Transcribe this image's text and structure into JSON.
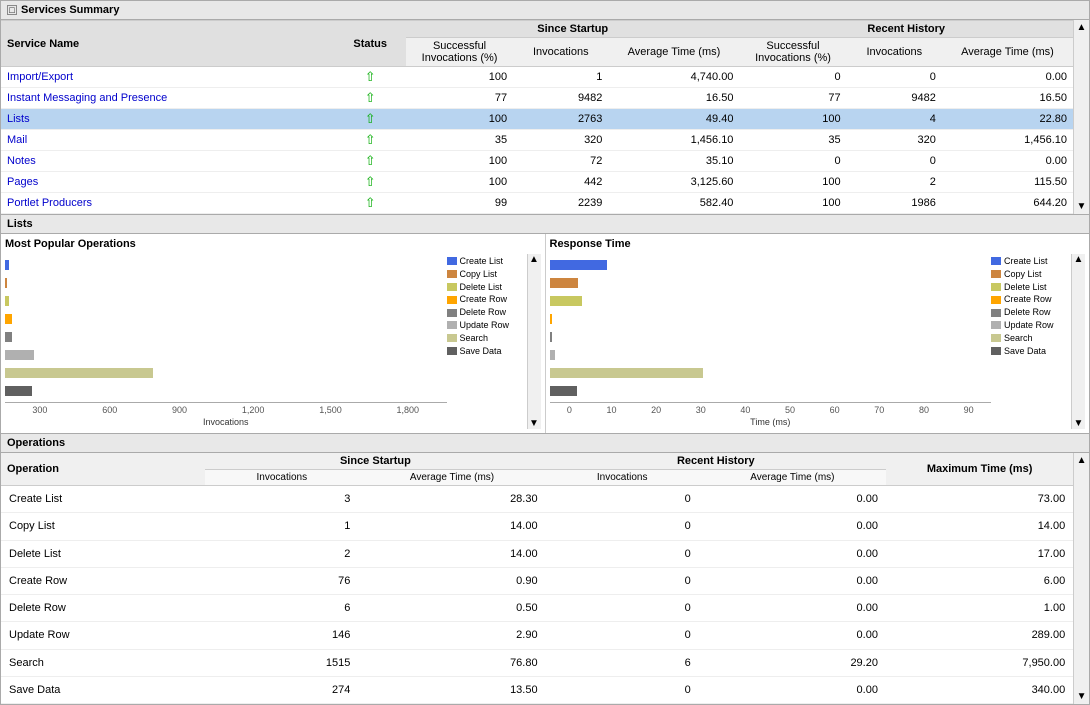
{
  "services_summary": {
    "title": "Services Summary",
    "columns": {
      "service_name": "Service Name",
      "status": "Status",
      "since_startup": "Since Startup",
      "recent_history": "Recent History",
      "successful_invocations": "Successful Invocations (%)",
      "invocations": "Invocations",
      "average_time": "Average Time (ms)"
    },
    "rows": [
      {
        "name": "Import/Export",
        "status": "up",
        "ss_pct": 100,
        "ss_inv": 1,
        "ss_avg": "4,740.00",
        "rh_pct": 0,
        "rh_inv": 0,
        "rh_avg": "0.00",
        "selected": false
      },
      {
        "name": "Instant Messaging and Presence",
        "status": "up",
        "ss_pct": 77,
        "ss_inv": 9482,
        "ss_avg": "16.50",
        "rh_pct": 77,
        "rh_inv": 9482,
        "rh_avg": "16.50",
        "selected": false
      },
      {
        "name": "Lists",
        "status": "up",
        "ss_pct": 100,
        "ss_inv": 2763,
        "ss_avg": "49.40",
        "rh_pct": 100,
        "rh_inv": 4,
        "rh_avg": "22.80",
        "selected": true
      },
      {
        "name": "Mail",
        "status": "up",
        "ss_pct": 35,
        "ss_inv": 320,
        "ss_avg": "1,456.10",
        "rh_pct": 35,
        "rh_inv": 320,
        "rh_avg": "1,456.10",
        "selected": false
      },
      {
        "name": "Notes",
        "status": "up",
        "ss_pct": 100,
        "ss_inv": 72,
        "ss_avg": "35.10",
        "rh_pct": 0,
        "rh_inv": 0,
        "rh_avg": "0.00",
        "selected": false
      },
      {
        "name": "Pages",
        "status": "up",
        "ss_pct": 100,
        "ss_inv": 442,
        "ss_avg": "3,125.60",
        "rh_pct": 100,
        "rh_inv": 2,
        "rh_avg": "115.50",
        "selected": false
      },
      {
        "name": "Portlet Producers",
        "status": "up",
        "ss_pct": 99,
        "ss_inv": 2239,
        "ss_avg": "582.40",
        "rh_pct": 100,
        "rh_inv": 1986,
        "rh_avg": "644.20",
        "selected": false
      }
    ]
  },
  "lists_panel": {
    "title": "Lists"
  },
  "most_popular": {
    "title": "Most Popular Operations",
    "x_label": "Invocations",
    "x_ticks": [
      "300",
      "600",
      "900",
      "1,200",
      "1,500",
      "1,800"
    ],
    "bars": [
      {
        "label": "Create List",
        "color": "#4169e1",
        "width_pct": 2
      },
      {
        "label": "Copy List",
        "color": "#cd853f",
        "width_pct": 1
      },
      {
        "label": "Delete List",
        "color": "#c8c860",
        "width_pct": 2
      },
      {
        "label": "Create Row",
        "color": "#ffa500",
        "width_pct": 4
      },
      {
        "label": "Delete Row",
        "color": "#808080",
        "width_pct": 4
      },
      {
        "label": "Update Row",
        "color": "#b0b0b0",
        "width_pct": 16
      },
      {
        "label": "Search",
        "color": "#c8c890",
        "width_pct": 82
      },
      {
        "label": "Save Data",
        "color": "#606060",
        "width_pct": 15
      }
    ]
  },
  "response_time": {
    "title": "Response Time",
    "x_label": "Time (ms)",
    "x_ticks": [
      "0",
      "10",
      "20",
      "30",
      "40",
      "50",
      "60",
      "70",
      "80",
      "90"
    ],
    "bars": [
      {
        "label": "Create List",
        "color": "#4169e1",
        "width_pct": 32
      },
      {
        "label": "Copy List",
        "color": "#cd853f",
        "width_pct": 16
      },
      {
        "label": "Delete List",
        "color": "#c8c860",
        "width_pct": 18
      },
      {
        "label": "Create Row",
        "color": "#ffa500",
        "width_pct": 1
      },
      {
        "label": "Delete Row",
        "color": "#808080",
        "width_pct": 1
      },
      {
        "label": "Update Row",
        "color": "#b0b0b0",
        "width_pct": 3
      },
      {
        "label": "Search",
        "color": "#c8c890",
        "width_pct": 85
      },
      {
        "label": "Save Data",
        "color": "#606060",
        "width_pct": 15
      }
    ]
  },
  "operations": {
    "title": "Operations",
    "rows": [
      {
        "name": "Create List",
        "ss_inv": 3,
        "ss_avg": "28.30",
        "rh_inv": 0,
        "rh_avg": "0.00",
        "max_time": "73.00"
      },
      {
        "name": "Copy List",
        "ss_inv": 1,
        "ss_avg": "14.00",
        "rh_inv": 0,
        "rh_avg": "0.00",
        "max_time": "14.00"
      },
      {
        "name": "Delete List",
        "ss_inv": 2,
        "ss_avg": "14.00",
        "rh_inv": 0,
        "rh_avg": "0.00",
        "max_time": "17.00"
      },
      {
        "name": "Create Row",
        "ss_inv": 76,
        "ss_avg": "0.90",
        "rh_inv": 0,
        "rh_avg": "0.00",
        "max_time": "6.00"
      },
      {
        "name": "Delete Row",
        "ss_inv": 6,
        "ss_avg": "0.50",
        "rh_inv": 0,
        "rh_avg": "0.00",
        "max_time": "1.00"
      },
      {
        "name": "Update Row",
        "ss_inv": 146,
        "ss_avg": "2.90",
        "rh_inv": 0,
        "rh_avg": "0.00",
        "max_time": "289.00"
      },
      {
        "name": "Search",
        "ss_inv": 1515,
        "ss_avg": "76.80",
        "rh_inv": 6,
        "rh_avg": "29.20",
        "max_time": "7,950.00"
      },
      {
        "name": "Save Data",
        "ss_inv": 274,
        "ss_avg": "13.50",
        "rh_inv": 0,
        "rh_avg": "0.00",
        "max_time": "340.00"
      }
    ]
  }
}
